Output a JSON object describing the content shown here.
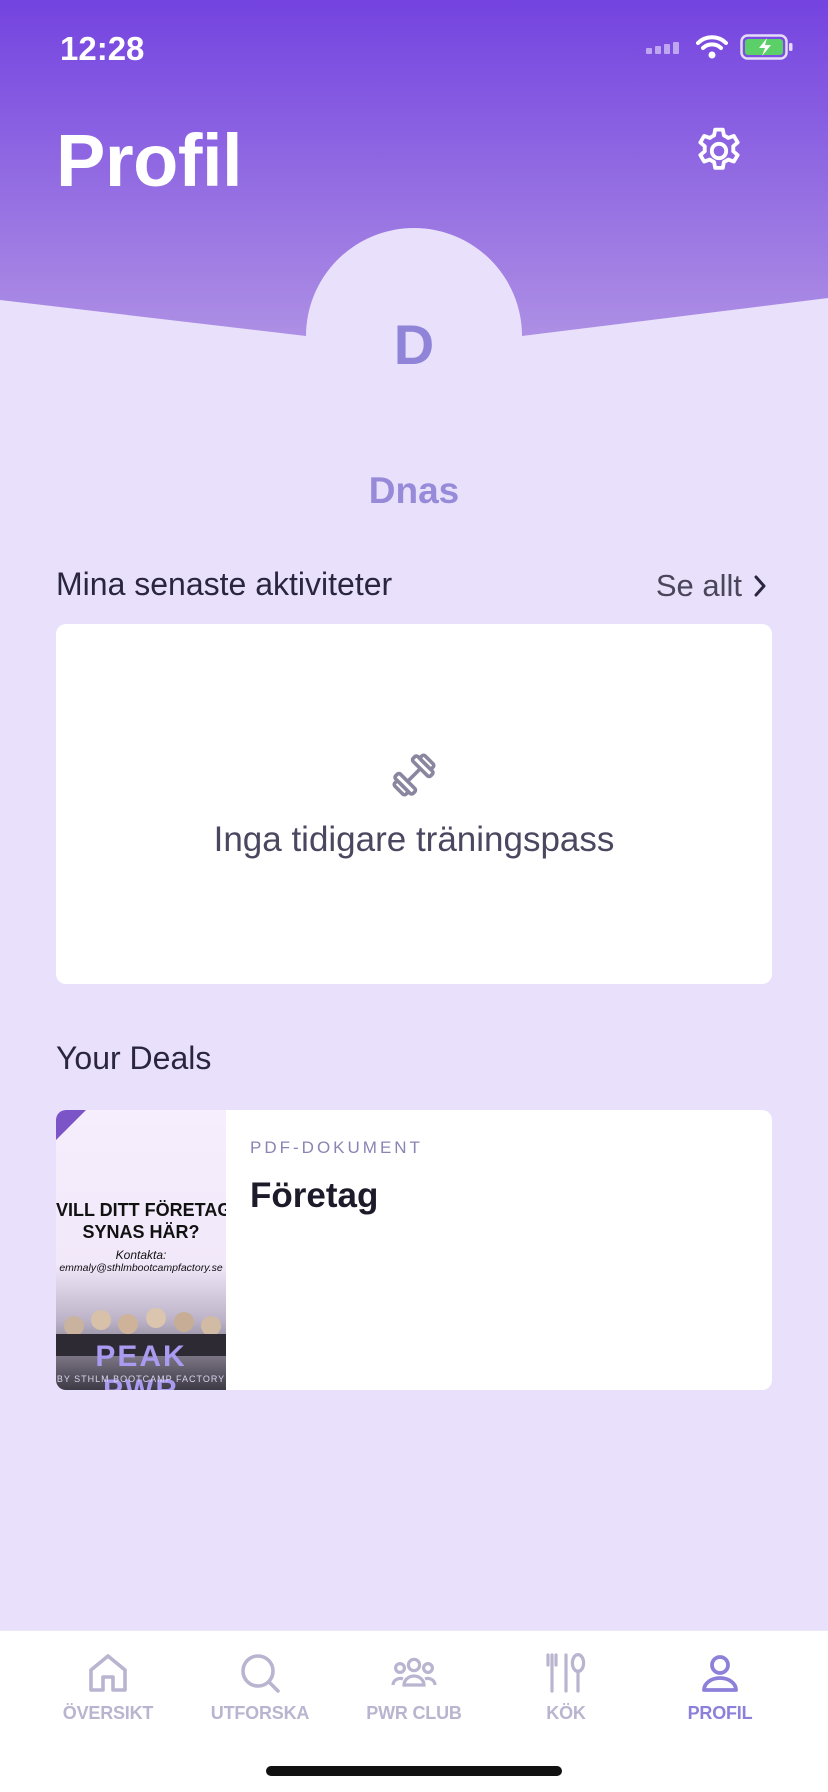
{
  "status_bar": {
    "time": "12:28"
  },
  "header": {
    "title": "Profil",
    "settings_icon": "gear-icon"
  },
  "profile": {
    "avatar_letter": "D",
    "username": "Dnas"
  },
  "activities": {
    "title": "Mina senaste aktiviteter",
    "see_all": "Se allt",
    "empty_icon": "dumbbell-icon",
    "empty_text": "Inga tidigare träningspass"
  },
  "deals": {
    "title": "Your Deals",
    "items": [
      {
        "type": "PDF-DOKUMENT",
        "title": "Företag",
        "thumb": {
          "line1": "VILL DITT FÖRETAG",
          "line2": "SYNAS HÄR?",
          "line3": "Kontakta:",
          "line4": "emmaly@sthlmbootcampfactory.se",
          "brand": "PEAK PWR",
          "brand_sub": "BY STHLM BOOTCAMP FACTORY"
        }
      }
    ]
  },
  "tabs": [
    {
      "label": "ÖVERSIKT",
      "icon": "home-icon",
      "active": false
    },
    {
      "label": "UTFORSKA",
      "icon": "search-icon",
      "active": false
    },
    {
      "label": "PWR CLUB",
      "icon": "group-icon",
      "active": false
    },
    {
      "label": "KÖK",
      "icon": "utensils-icon",
      "active": false
    },
    {
      "label": "PROFIL",
      "icon": "person-icon",
      "active": true
    }
  ],
  "colors": {
    "header_top": "#7443e0",
    "header_bottom": "#a887e3",
    "background": "#e9e1fb",
    "accent": "#8c80da"
  }
}
